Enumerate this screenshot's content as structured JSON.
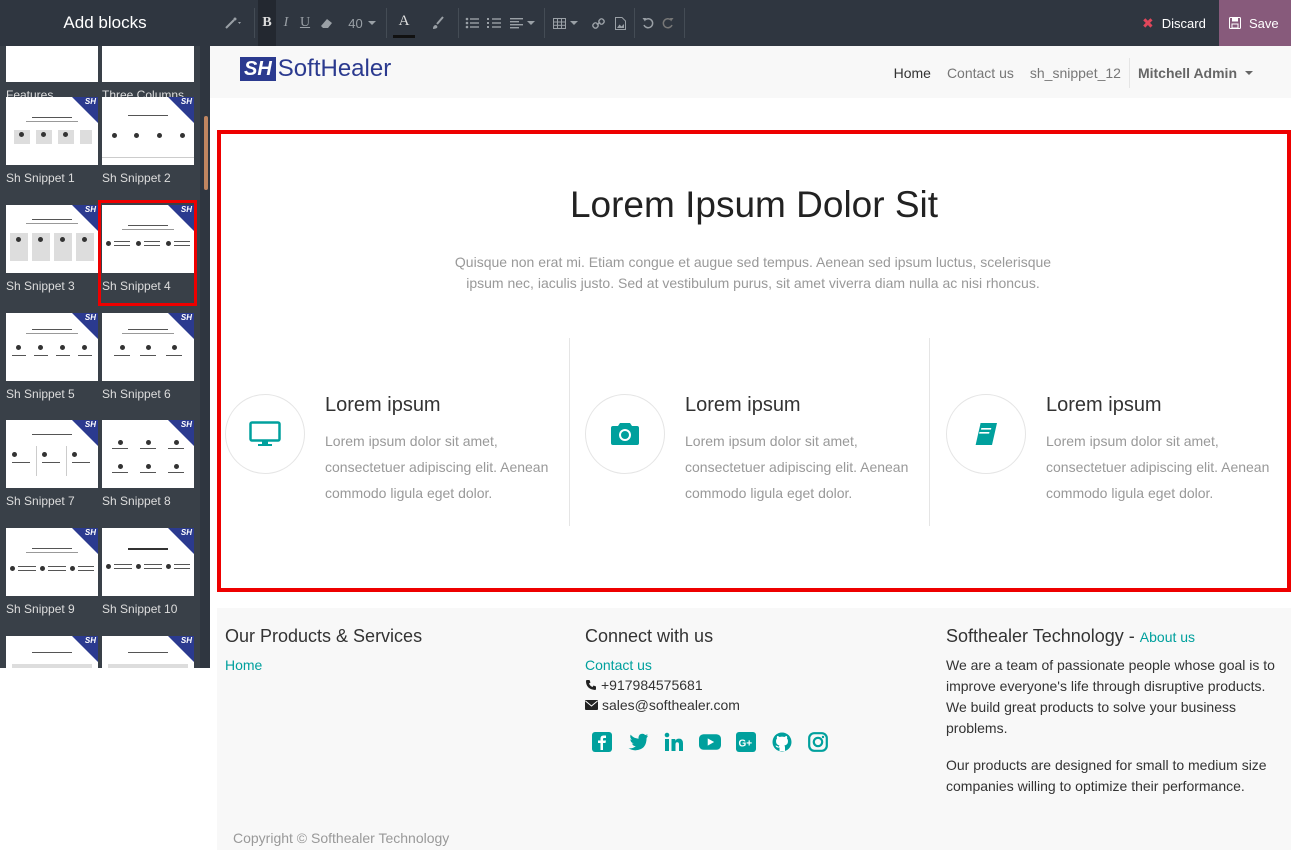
{
  "sidebar": {
    "title": "Add blocks",
    "blocks": [
      {
        "label": "Features"
      },
      {
        "label": "Three Columns"
      },
      {
        "label": "Sh Snippet 1"
      },
      {
        "label": "Sh Snippet 2"
      },
      {
        "label": "Sh Snippet 3"
      },
      {
        "label": "Sh Snippet 4"
      },
      {
        "label": "Sh Snippet 5"
      },
      {
        "label": "Sh Snippet 6"
      },
      {
        "label": "Sh Snippet 7"
      },
      {
        "label": "Sh Snippet 8"
      },
      {
        "label": "Sh Snippet 9"
      },
      {
        "label": "Sh Snippet 10"
      }
    ],
    "selected_block": "Sh Snippet 4",
    "thumb_badge": "SH"
  },
  "toolbar": {
    "font_size": "40",
    "discard_label": "Discard",
    "save_label": "Save"
  },
  "header": {
    "logo_mark": "SH",
    "logo_text": "SoftHealer",
    "nav": {
      "home": "Home",
      "contact": "Contact us",
      "snippet": "sh_snippet_12",
      "user": "Mitchell Admin"
    }
  },
  "hero": {
    "title": "Lorem Ipsum Dolor Sit",
    "subtitle": "Quisque non erat mi. Etiam congue et augue sed tempus. Aenean sed ipsum luctus, scelerisque ipsum nec, iaculis justo. Sed at vestibulum purus, sit amet viverra diam nulla ac nisi rhoncus."
  },
  "features": [
    {
      "icon": "monitor-icon",
      "title": "Lorem ipsum",
      "text": "Lorem ipsum dolor sit amet, consectetuer adipiscing elit. Aenean commodo ligula eget dolor."
    },
    {
      "icon": "camera-icon",
      "title": "Lorem ipsum",
      "text": "Lorem ipsum dolor sit amet, consectetuer adipiscing elit. Aenean commodo ligula eget dolor."
    },
    {
      "icon": "book-icon",
      "title": "Lorem ipsum",
      "text": "Lorem ipsum dolor sit amet, consectetuer adipiscing elit. Aenean commodo ligula eget dolor."
    }
  ],
  "footer": {
    "col1": {
      "title": "Our Products & Services",
      "link": "Home"
    },
    "col2": {
      "title": "Connect with us",
      "link": "Contact us",
      "phone": "+917984575681",
      "email": "sales@softhealer.com",
      "social": [
        "facebook-icon",
        "twitter-icon",
        "linkedin-icon",
        "youtube-icon",
        "google-plus-icon",
        "github-icon",
        "instagram-icon"
      ]
    },
    "col3": {
      "title": "Softhealer Technology",
      "title_sep": " - ",
      "about": "About us",
      "p1": "We are a team of passionate people whose goal is to improve everyone's life through disruptive products. We build great products to solve your business problems.",
      "p2": "Our products are designed for small to medium size companies willing to optimize their performance."
    },
    "copyright": "Copyright © Softhealer Technology"
  },
  "colors": {
    "accent": "#00a09d",
    "brand": "#2b3a8f",
    "save": "#875a7b",
    "selection": "#ee0000"
  }
}
